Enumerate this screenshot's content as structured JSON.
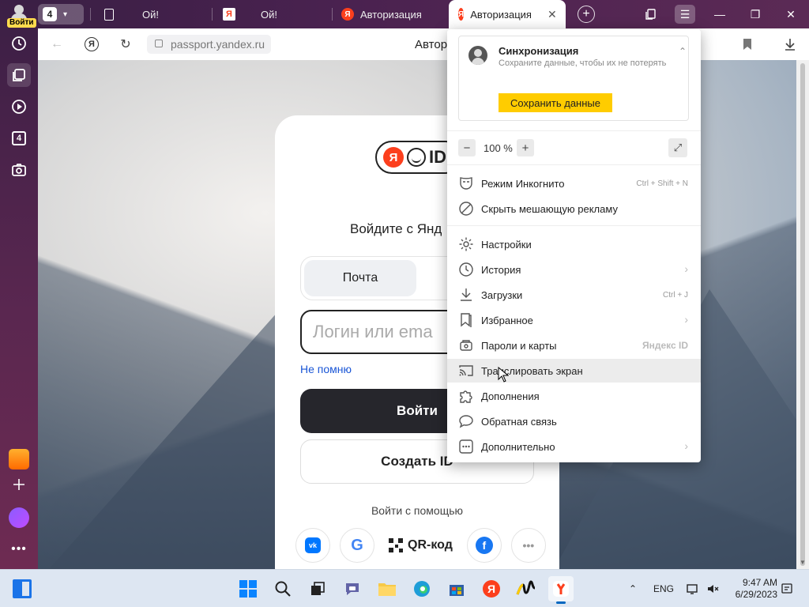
{
  "sidebar": {
    "profile_badge": "Войти",
    "tab_count": "4"
  },
  "tabs": {
    "group_count": "4",
    "items": [
      {
        "title": "Ой!",
        "favicon": "doc"
      },
      {
        "title": "Ой!",
        "favicon": "yandex-square"
      },
      {
        "title": "Авторизация",
        "favicon": "yandex"
      },
      {
        "title": "Авторизация",
        "favicon": "yandex",
        "active": true
      }
    ]
  },
  "toolbar": {
    "url": "passport.yandex.ru",
    "page_title": "Автор"
  },
  "login": {
    "logo_text": "ID",
    "logo_ya": "Я",
    "heading": "Войдите с Янд",
    "tab_mail": "Почта",
    "input_placeholder": "Логин или ema",
    "forgot": "Не помню",
    "submit": "Войти",
    "create": "Создать ID",
    "social_title": "Войти с помощью",
    "social": {
      "vk": "vk",
      "google": "G",
      "qr": "QR-код",
      "facebook": "f",
      "more": "•••"
    }
  },
  "menu": {
    "sync": {
      "title": "Синхронизация",
      "subtitle": "Сохраните данные, чтобы их не потерять",
      "button": "Сохранить данные"
    },
    "zoom": {
      "minus": "−",
      "value": "100 %",
      "plus": "+"
    },
    "items": [
      {
        "label": "Режим Инкогнито",
        "shortcut": "Ctrl + Shift + N",
        "icon": "incognito-mask-icon"
      },
      {
        "label": "Скрыть мешающую рекламу",
        "icon": "block-ads-icon"
      },
      {
        "label": "Настройки",
        "icon": "gear-icon"
      },
      {
        "label": "История",
        "icon": "clock-icon",
        "submenu": true
      },
      {
        "label": "Загрузки",
        "shortcut": "Ctrl + J",
        "icon": "download-icon"
      },
      {
        "label": "Избранное",
        "icon": "bookmark-icon",
        "submenu": true
      },
      {
        "label": "Пароли и карты",
        "brand": "Яндекс ID",
        "icon": "key-icon"
      },
      {
        "label": "Транслировать экран",
        "icon": "cast-icon",
        "hovered": true
      },
      {
        "label": "Дополнения",
        "icon": "puzzle-icon"
      },
      {
        "label": "Обратная связь",
        "icon": "chat-icon"
      },
      {
        "label": "Дополнительно",
        "icon": "more-icon",
        "submenu": true
      }
    ]
  },
  "taskbar": {
    "language": "ENG",
    "time": "9:47 AM",
    "date": "6/29/2023"
  },
  "colors": {
    "yandex_red": "#fc3f1d",
    "sync_yellow": "#ffcc00",
    "login_button": "#26262c",
    "link_blue": "#1a56d6"
  }
}
